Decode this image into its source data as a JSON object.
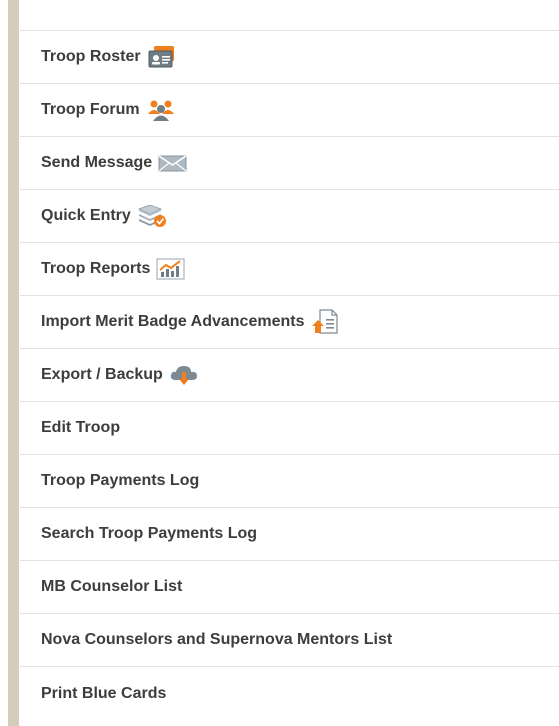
{
  "menu": {
    "items": [
      {
        "label": "Troop Roster",
        "icon": "id-card-icon"
      },
      {
        "label": "Troop Forum",
        "icon": "people-group-icon"
      },
      {
        "label": "Send Message",
        "icon": "envelope-icon"
      },
      {
        "label": "Quick Entry",
        "icon": "stack-check-icon"
      },
      {
        "label": "Troop Reports",
        "icon": "chart-icon"
      },
      {
        "label": "Import Merit Badge Advancements",
        "icon": "document-upload-icon"
      },
      {
        "label": "Export / Backup",
        "icon": "cloud-download-icon"
      },
      {
        "label": "Edit Troop"
      },
      {
        "label": "Troop Payments Log"
      },
      {
        "label": "Search Troop Payments Log"
      },
      {
        "label": "MB Counselor List"
      },
      {
        "label": "Nova Counselors and Supernova Mentors List"
      },
      {
        "label": "Print Blue Cards"
      }
    ]
  },
  "colors": {
    "rail": "#d6ccbb",
    "text": "#3d3d3d",
    "divider": "#e2e2e2",
    "accent_orange": "#f07f1e"
  }
}
